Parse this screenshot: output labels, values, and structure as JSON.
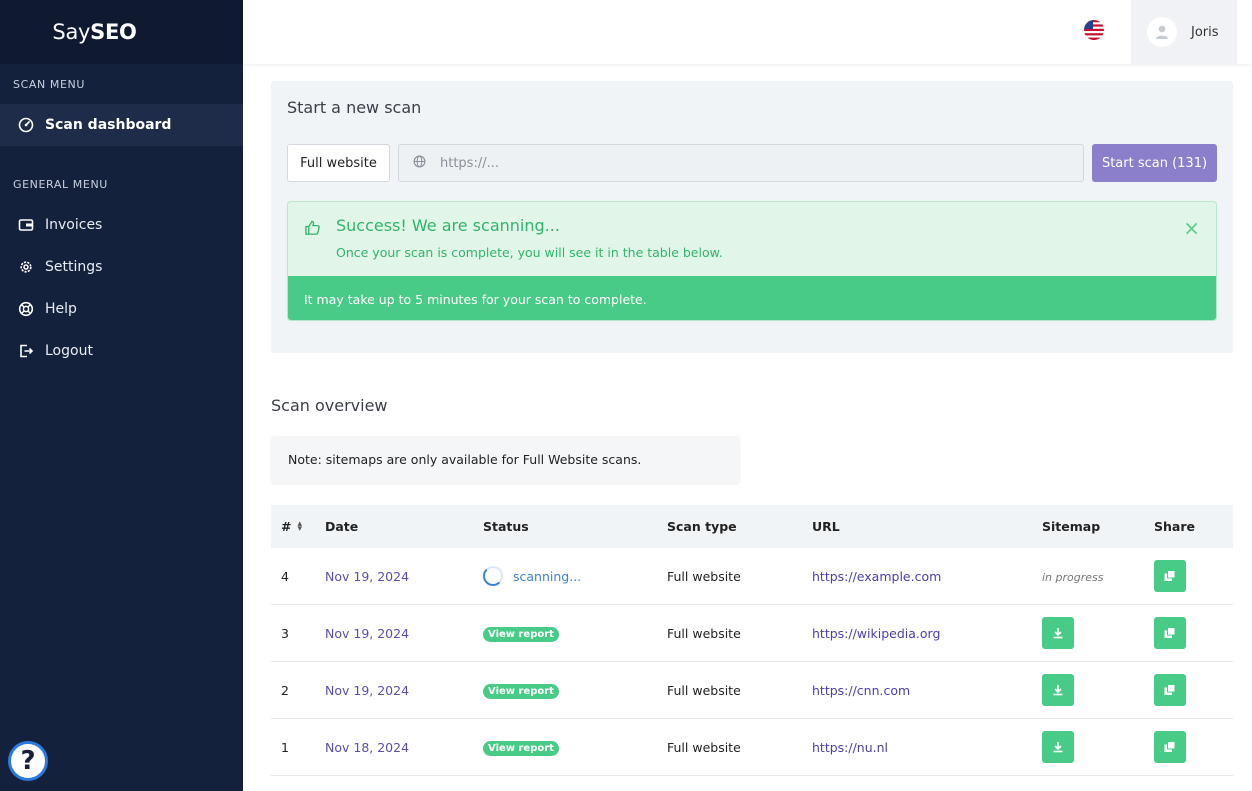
{
  "brand": {
    "part1": "Say",
    "part2": "SEO"
  },
  "sidebar": {
    "scan_menu_title": "SCAN MENU",
    "general_menu_title": "GENERAL MENU",
    "items": [
      {
        "label": "Scan dashboard",
        "icon": "gauge-icon"
      },
      {
        "label": "Invoices",
        "icon": "wallet-icon"
      },
      {
        "label": "Settings",
        "icon": "gear-icon"
      },
      {
        "label": "Help",
        "icon": "lifebuoy-icon"
      },
      {
        "label": "Logout",
        "icon": "logout-icon"
      }
    ],
    "help_fab": "?"
  },
  "topbar": {
    "user_name": "Joris",
    "language_flag": "us-flag-icon"
  },
  "scan": {
    "title": "Start a new scan",
    "type_label": "Full website",
    "url_placeholder": "https://...",
    "start_label": "Start scan (131)"
  },
  "alert": {
    "title": "Success! We are scanning...",
    "text": "Once your scan is complete, you will see it in the table below.",
    "footer": "It may take up to 5 minutes for your scan to complete.",
    "close": "×"
  },
  "overview": {
    "title": "Scan overview",
    "note": "Note: sitemaps are only available for Full Website scans."
  },
  "table": {
    "headers": {
      "num": "#",
      "date": "Date",
      "status": "Status",
      "type": "Scan type",
      "url": "URL",
      "sitemap": "Sitemap",
      "share": "Share"
    },
    "rows": [
      {
        "num": "4",
        "date": "Nov 19, 2024",
        "status": "scanning...",
        "type": "Full website",
        "url": "https://example.com",
        "sitemap": "in progress"
      },
      {
        "num": "3",
        "date": "Nov 19, 2024",
        "status": "View report",
        "type": "Full website",
        "url": "https://wikipedia.org",
        "sitemap": ""
      },
      {
        "num": "2",
        "date": "Nov 19, 2024",
        "status": "View report",
        "type": "Full website",
        "url": "https://cnn.com",
        "sitemap": ""
      },
      {
        "num": "1",
        "date": "Nov 18, 2024",
        "status": "View report",
        "type": "Full website",
        "url": "https://nu.nl",
        "sitemap": ""
      }
    ]
  },
  "colors": {
    "sidebar": "#14213d",
    "accent": "#8b7ecb",
    "success": "#48cb86"
  }
}
